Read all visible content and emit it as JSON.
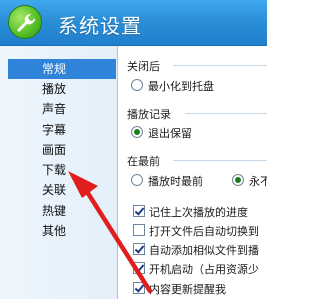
{
  "window": {
    "title": "系统设置"
  },
  "sidebar": {
    "items": [
      {
        "label": "常规",
        "active": true
      },
      {
        "label": "播放"
      },
      {
        "label": "声音"
      },
      {
        "label": "字幕"
      },
      {
        "label": "画面"
      },
      {
        "label": "下载"
      },
      {
        "label": "关联"
      },
      {
        "label": "热键"
      },
      {
        "label": "其他"
      }
    ]
  },
  "main": {
    "close_section": {
      "title": "关闭后",
      "option": "最小化到托盘"
    },
    "history_section": {
      "title": "播放记录",
      "option": "退出保留"
    },
    "top_section": {
      "title": "在最前",
      "option1": "播放时最前",
      "option2": "永不"
    },
    "checkboxes": [
      {
        "label": "记住上次播放的进度",
        "checked": true
      },
      {
        "label": "打开文件后自动切换到",
        "checked": false
      },
      {
        "label": "自动添加相似文件到播",
        "checked": true
      },
      {
        "label": "开机启动（占用资源少",
        "checked": true
      },
      {
        "label": "内容更新提醒我",
        "checked": true
      }
    ]
  },
  "annotation": {
    "color": "#e01e1e"
  }
}
